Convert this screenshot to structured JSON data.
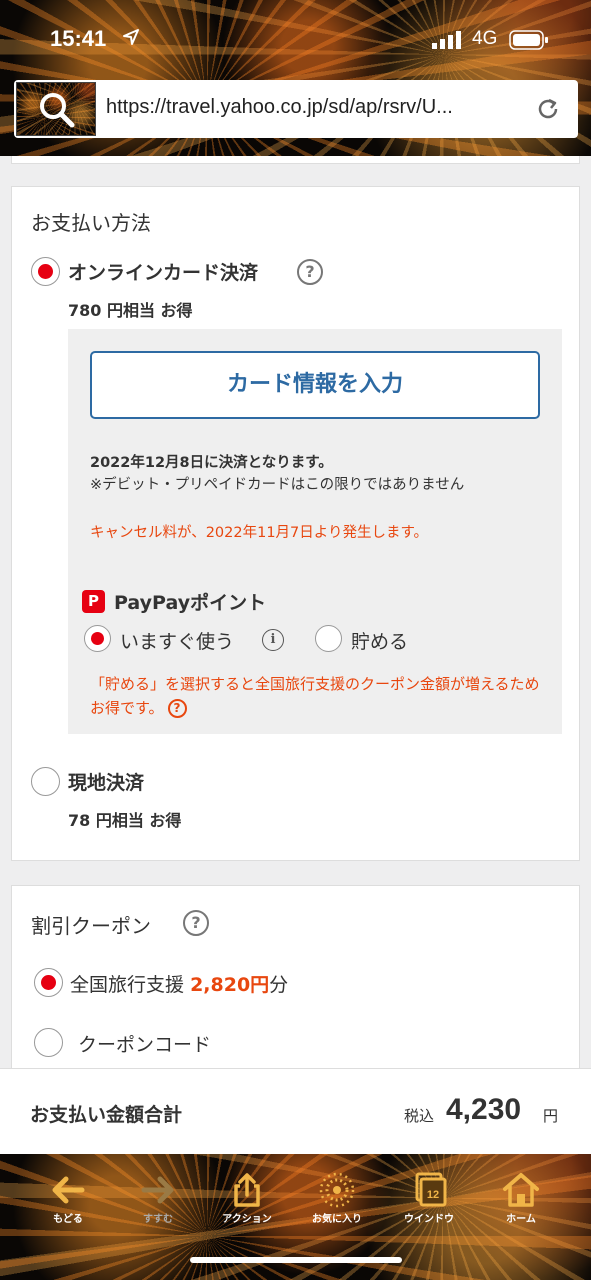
{
  "status_bar": {
    "time": "15:41",
    "network": "4G"
  },
  "browser": {
    "url": "https://travel.yahoo.co.jp/sd/ap/rsrv/U..."
  },
  "payment": {
    "title": "お支払い方法",
    "online": {
      "label": "オンラインカード決済",
      "benefit": "780 円相当 お得",
      "selected": true,
      "card_button": "カード情報を入力",
      "settle_note": "2022年12月8日に決済となります。",
      "debit_note": "※デビット・プリペイドカードはこの限りではありません",
      "cancel_note": "キャンセル料が、2022年11月7日より発生します。",
      "paypay": {
        "logo": "P",
        "title": "PayPayポイント",
        "use_now": "いますぐ使う",
        "save": "貯める",
        "selected": "いますぐ使う",
        "note": "「貯める」を選択すると全国旅行支援のクーポン金額が増えるためお得です。"
      }
    },
    "onsite": {
      "label": "現地決済",
      "benefit": "78 円相当 お得",
      "selected": false
    }
  },
  "coupon": {
    "title": "割引クーポン",
    "travel_support_label": "全国旅行支援",
    "travel_support_amount": "2,820円",
    "travel_support_suffix": "分",
    "coupon_code_label": "クーポンコード"
  },
  "total": {
    "label": "お支払い金額合計",
    "tax_label": "税込",
    "amount": "4,230",
    "unit": "円"
  },
  "toolbar": {
    "back": "もどる",
    "forward": "すすむ",
    "action": "アクション",
    "favorites": "お気に入り",
    "windows": "ウインドウ",
    "windows_count": "12",
    "home": "ホーム"
  },
  "colors": {
    "accent_red": "#e60012",
    "note_orange": "#e8470f",
    "button_blue": "#2d6aa3",
    "toolbar_icon": "#f0b548"
  }
}
